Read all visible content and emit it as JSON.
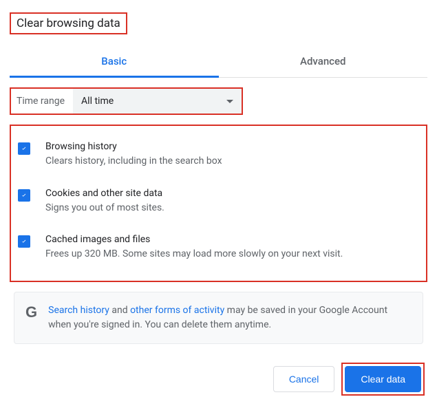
{
  "title": "Clear browsing data",
  "tabs": {
    "basic": "Basic",
    "advanced": "Advanced"
  },
  "timeRange": {
    "label": "Time range",
    "value": "All time"
  },
  "options": [
    {
      "title": "Browsing history",
      "desc": "Clears history, including in the search box",
      "checked": true
    },
    {
      "title": "Cookies and other site data",
      "desc": "Signs you out of most sites.",
      "checked": true
    },
    {
      "title": "Cached images and files",
      "desc": "Frees up 320 MB. Some sites may load more slowly on your next visit.",
      "checked": true
    }
  ],
  "info": {
    "link1": "Search history",
    "mid1": " and ",
    "link2": "other forms of activity",
    "rest": " may be saved in your Google Account when you're signed in. You can delete them anytime."
  },
  "buttons": {
    "cancel": "Cancel",
    "clear": "Clear data"
  }
}
